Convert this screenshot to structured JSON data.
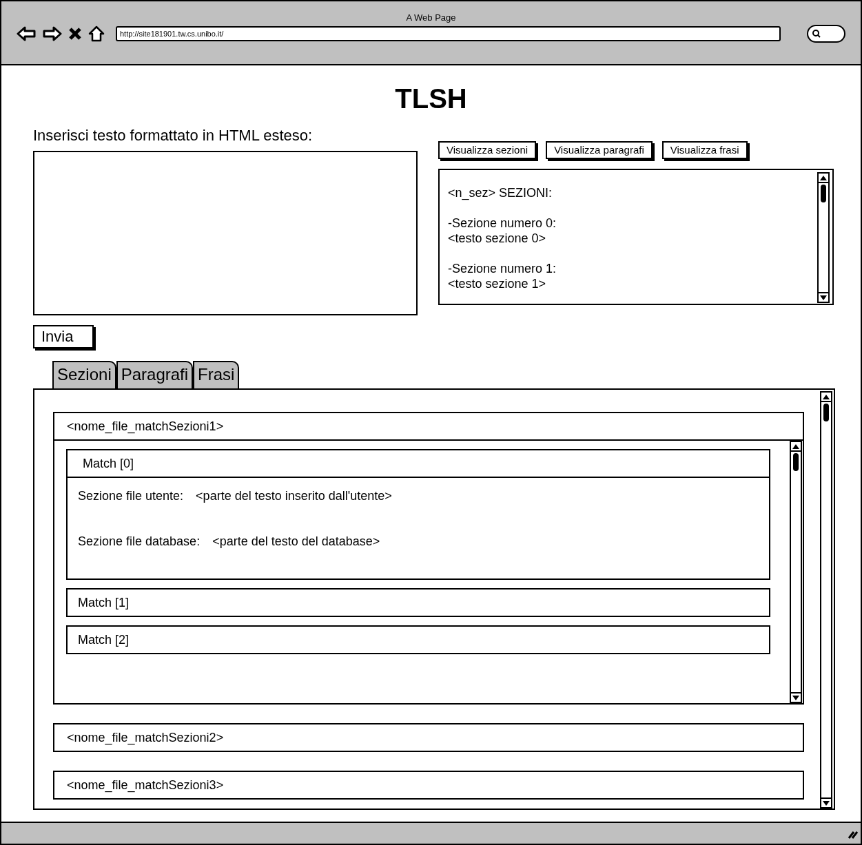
{
  "window": {
    "title": "A Web Page",
    "url": "http://site181901.tw.cs.unibo.it/"
  },
  "page_title": "TLSH",
  "input": {
    "label": "Inserisci testo formattato in HTML esteso:",
    "submit": "Invia"
  },
  "view_buttons": [
    "Visualizza sezioni",
    "Visualizza paragrafi",
    "Visualizza frasi"
  ],
  "output_blocks": [
    [
      "<n_sez> SEZIONI:"
    ],
    [
      "-Sezione numero 0:",
      "<testo sezione 0>"
    ],
    [
      "-Sezione numero 1:",
      "<testo sezione 1>"
    ]
  ],
  "tabs": [
    {
      "label": "Sezioni",
      "selected": false
    },
    {
      "label": "Paragrafi",
      "selected": false
    },
    {
      "label": "Frasi",
      "selected": false
    }
  ],
  "files": [
    {
      "name": "<nome_file_matchSezioni1>",
      "expanded": true,
      "matches": [
        {
          "title": "Match [0]",
          "expanded": true,
          "fields": [
            {
              "label": "Sezione file utente:",
              "value": "<parte del testo inserito dall'utente>"
            },
            {
              "label": "Sezione file database:",
              "value": "<parte del testo del database>"
            }
          ]
        },
        {
          "title": "Match [1]",
          "expanded": false
        },
        {
          "title": "Match [2]",
          "expanded": false
        }
      ]
    },
    {
      "name": "<nome_file_matchSezioni2>",
      "expanded": false
    },
    {
      "name": "<nome_file_matchSezioni3>",
      "expanded": false
    }
  ]
}
